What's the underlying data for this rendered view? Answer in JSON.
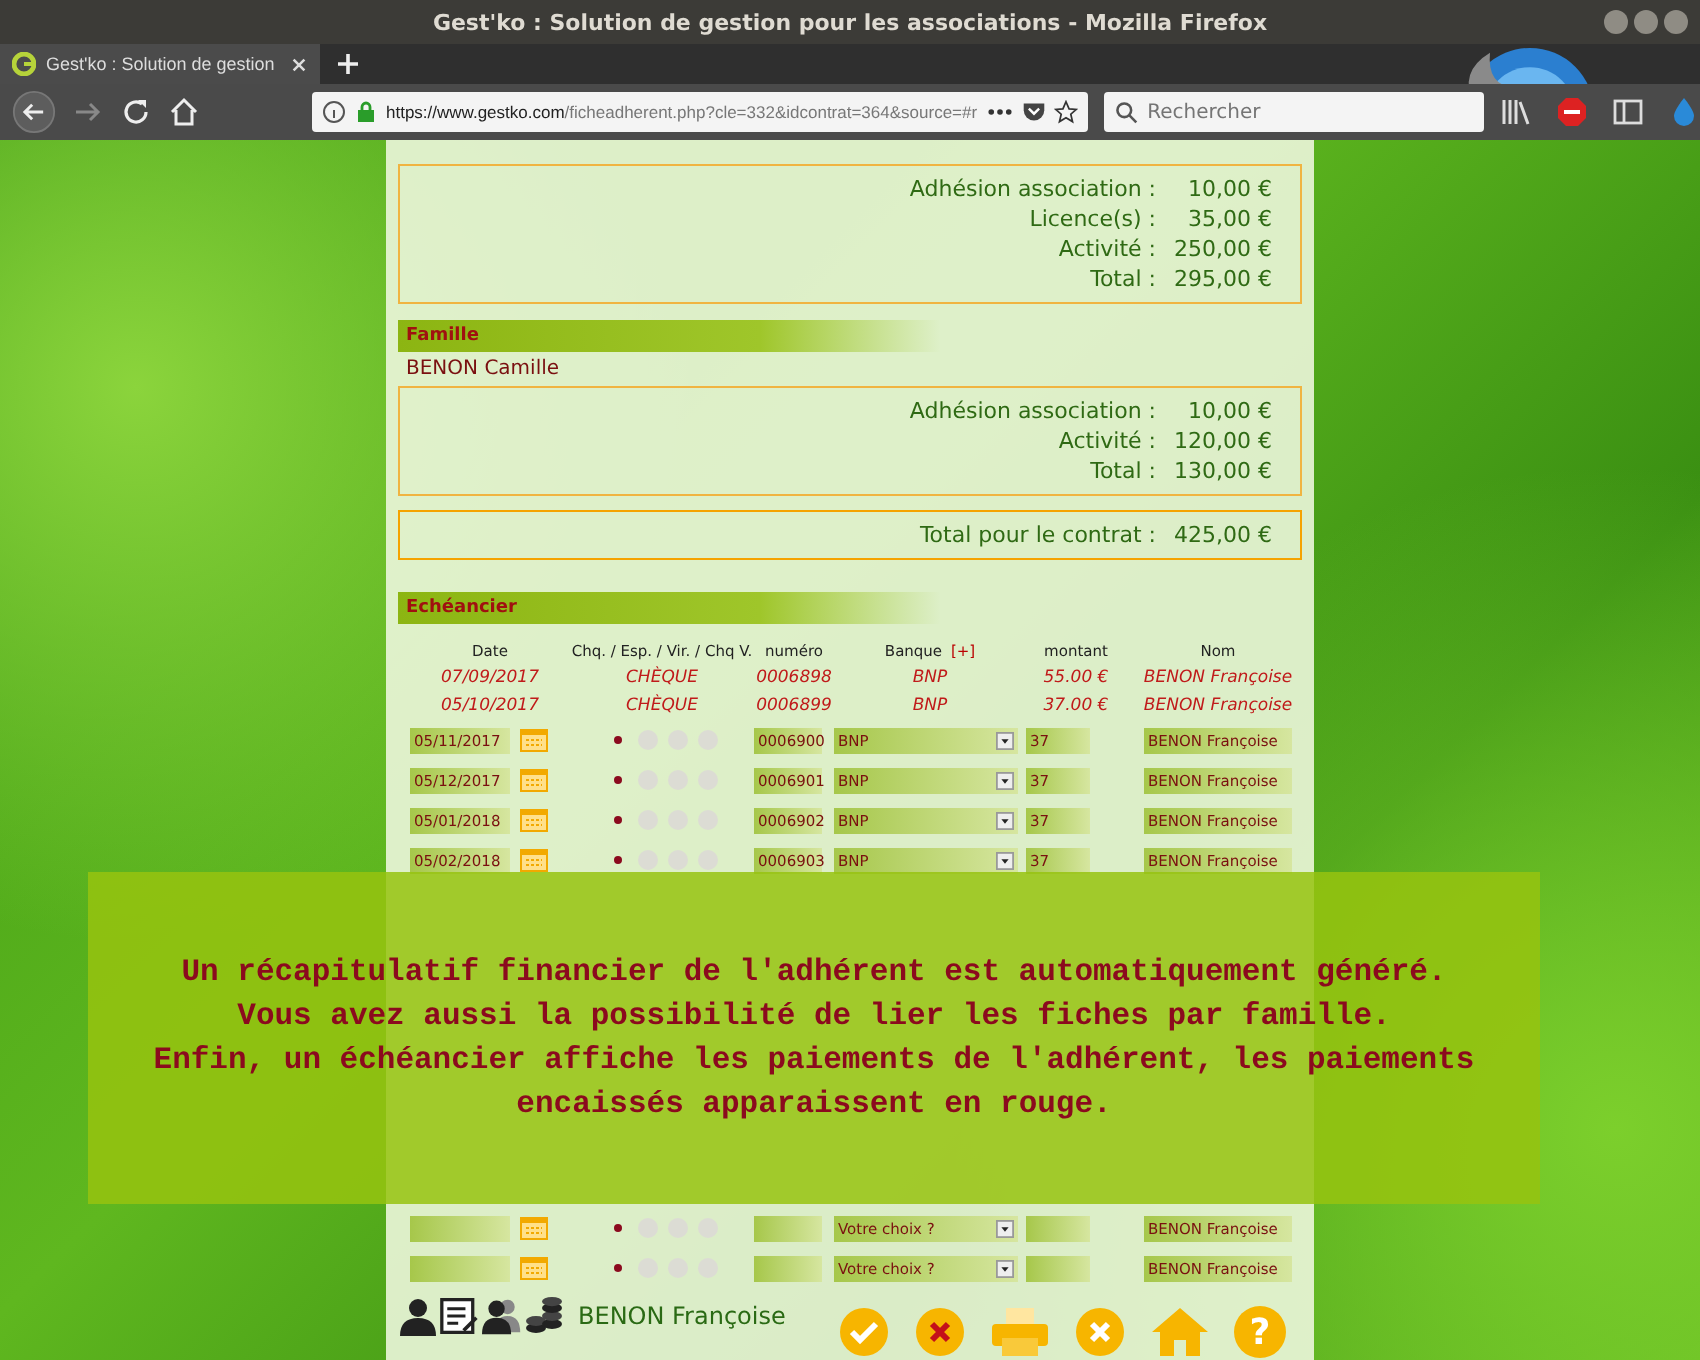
{
  "window": {
    "title": "Gest'ko : Solution de gestion pour les associations - Mozilla Firefox"
  },
  "browser": {
    "tab_title": "Gest'ko : Solution de gestion",
    "url_domain": "https://www.gestko.com",
    "url_path": "/ficheadherent.php?cle=332&idcontrat=364&source=#r",
    "search_placeholder": "Rechercher",
    "forward_disabled": true
  },
  "summary": [
    {
      "lines": [
        {
          "label": "Adhésion association :",
          "amount": "10,00 €"
        },
        {
          "label": "Licence(s) :",
          "amount": "35,00 €"
        },
        {
          "label": "Activité :",
          "amount": "250,00 €"
        },
        {
          "label": "Total :",
          "amount": "295,00 €"
        }
      ]
    }
  ],
  "famille": {
    "heading": "Famille",
    "member": "BENON Camille",
    "lines": [
      {
        "label": "Adhésion association :",
        "amount": "10,00 €"
      },
      {
        "label": "Activité :",
        "amount": "120,00 €"
      },
      {
        "label": "Total :",
        "amount": "130,00 €"
      }
    ]
  },
  "contract_total": {
    "label": "Total pour le contrat :",
    "amount": "425,00 €"
  },
  "echeancier": {
    "heading": "Echéancier",
    "columns": [
      {
        "label": "Date"
      },
      {
        "label": "Chq. / Esp. / Vir. / Chq V."
      },
      {
        "label": "numéro"
      },
      {
        "label": "Banque",
        "link": "[+]"
      },
      {
        "label": "montant"
      },
      {
        "label": "Nom"
      }
    ],
    "rows": [
      {
        "kind": "paid",
        "date": "07/09/2017",
        "mode": "CHÈQUE",
        "number": "0006898",
        "bank": "BNP",
        "amount": "55.00 €",
        "name": "BENON Françoise"
      },
      {
        "kind": "paid",
        "date": "05/10/2017",
        "mode": "CHÈQUE",
        "number": "0006899",
        "bank": "BNP",
        "amount": "37.00 €",
        "name": "BENON Françoise"
      },
      {
        "kind": "editable",
        "date": "05/11/2017",
        "modes": [
          {
            "selected": true
          },
          {
            "selected": false
          },
          {
            "selected": false
          },
          {
            "selected": false
          }
        ],
        "number": "0006900",
        "bank": "BNP",
        "amount": "37",
        "name": "BENON Françoise"
      },
      {
        "kind": "editable",
        "date": "05/12/2017",
        "modes": [
          {
            "selected": true
          },
          {
            "selected": false
          },
          {
            "selected": false
          },
          {
            "selected": false
          }
        ],
        "number": "0006901",
        "bank": "BNP",
        "amount": "37",
        "name": "BENON Françoise"
      },
      {
        "kind": "editable",
        "date": "05/01/2018",
        "modes": [
          {
            "selected": true
          },
          {
            "selected": false
          },
          {
            "selected": false
          },
          {
            "selected": false
          }
        ],
        "number": "0006902",
        "bank": "BNP",
        "amount": "37",
        "name": "BENON Françoise"
      },
      {
        "kind": "editable",
        "date": "05/02/2018",
        "modes": [
          {
            "selected": true
          },
          {
            "selected": false
          },
          {
            "selected": false
          },
          {
            "selected": false
          }
        ],
        "number": "0006903",
        "bank": "BNP",
        "amount": "37",
        "name": "BENON Françoise"
      },
      {
        "kind": "hidden"
      },
      {
        "kind": "editable",
        "modes": [
          {
            "selected": true
          },
          {
            "selected": false
          },
          {
            "selected": false
          },
          {
            "selected": false
          }
        ],
        "bank": "Votre choix ?",
        "name": "BENON Françoise"
      },
      {
        "kind": "editable",
        "modes": [
          {
            "selected": true
          },
          {
            "selected": false
          },
          {
            "selected": false
          },
          {
            "selected": false
          }
        ],
        "bank": "Votre choix ?",
        "name": "BENON Françoise"
      }
    ]
  },
  "overlay": {
    "paragraphs": [
      "Un récapitulatif financier de l'adhérent est automatiquement généré.",
      "Vous avez aussi la possibilité de lier les fiches par famille.",
      "Enfin, un échéancier affiche les paiements de l'adhérent, les paiements encaissés apparaissent en rouge."
    ]
  },
  "footer": {
    "name": "BENON Françoise",
    "buttons": [
      {
        "kind": "validate"
      },
      {
        "kind": "cancel"
      },
      {
        "kind": "print"
      },
      {
        "kind": "delete"
      },
      {
        "kind": "home"
      },
      {
        "kind": "help",
        "label": "?"
      }
    ]
  }
}
